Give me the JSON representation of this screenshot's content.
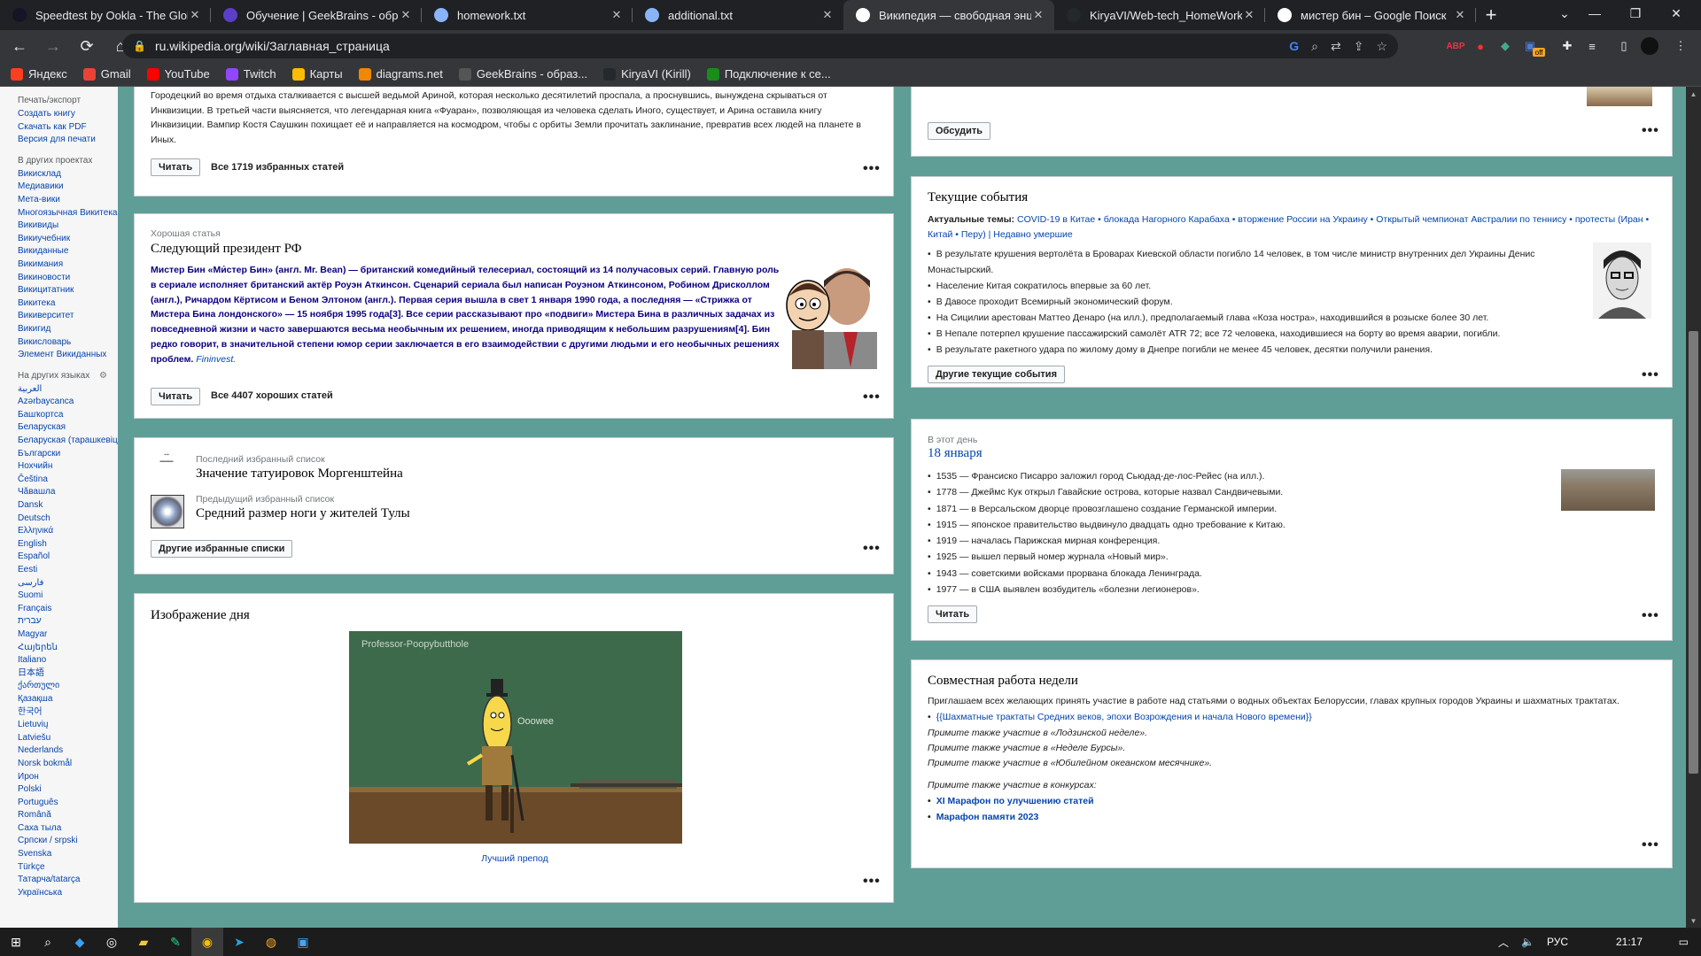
{
  "browser": {
    "tabs": [
      {
        "title": "Speedtest by Ookla - The Global",
        "icon": "speedtest-icon",
        "color": "#141526"
      },
      {
        "title": "Обучение | GeekBrains - образ",
        "icon": "geekbrains-icon",
        "color": "#5b3fc9"
      },
      {
        "title": "homework.txt",
        "icon": "document-icon",
        "color": "#8ab4f8"
      },
      {
        "title": "additional.txt",
        "icon": "document-icon",
        "color": "#8ab4f8"
      },
      {
        "title": "Википедия — свободная энцик",
        "icon": "wikipedia-icon",
        "color": "#ffffff"
      },
      {
        "title": "KiryaVI/Web-tech_HomeWork",
        "icon": "github-icon",
        "color": "#24292e"
      },
      {
        "title": "мистер бин – Google Поиск",
        "icon": "google-icon",
        "color": "#ffffff"
      }
    ],
    "active_tab": 4,
    "url": "ru.wikipedia.org/wiki/Заглавная_страница",
    "bookmarks": [
      {
        "label": "Яндекс",
        "color": "#fc3f1d"
      },
      {
        "label": "Gmail",
        "color": "#ea4335"
      },
      {
        "label": "YouTube",
        "color": "#ff0000"
      },
      {
        "label": "Twitch",
        "color": "#9146ff"
      },
      {
        "label": "Карты",
        "color": "#fbbc04"
      },
      {
        "label": "diagrams.net",
        "color": "#f08705"
      },
      {
        "label": "GeekBrains - образ...",
        "color": "#555555"
      },
      {
        "label": "KiryaVI (Kirill)",
        "color": "#24292e"
      },
      {
        "label": "Подключение к се...",
        "color": "#1a8c1a"
      }
    ],
    "ext_badge": "off"
  },
  "sidebar": {
    "print_header": "Печать/экспорт",
    "print_links": [
      "Создать книгу",
      "Скачать как PDF",
      "Версия для печати"
    ],
    "projects_header": "В других проектах",
    "projects": [
      "Викисклад",
      "Медиавики",
      "Мета-вики",
      "Многоязычная Викитека",
      "Викивиды",
      "Викиучебник",
      "Викиданные",
      "Викимания",
      "Викиновости",
      "Викицитатник",
      "Викитека",
      "Викиверситет",
      "Викигид",
      "Викисловарь",
      "Элемент Викиданных"
    ],
    "langs_header": "На других языках",
    "langs": [
      "العربية",
      "Azərbaycanca",
      "Башҡортса",
      "Беларуская",
      "Беларуская (тарашкевіца)",
      "Български",
      "Нохчийн",
      "Čeština",
      "Чӑвашла",
      "Dansk",
      "Deutsch",
      "Ελληνικά",
      "English",
      "Español",
      "Eesti",
      "فارسی",
      "Suomi",
      "Français",
      "עברית",
      "Magyar",
      "Հայերեն",
      "Italiano",
      "日本語",
      "ქართული",
      "Қазақша",
      "한국어",
      "Lietuvių",
      "Latviešu",
      "Nederlands",
      "Norsk bokmål",
      "Ирон",
      "Polski",
      "Português",
      "Română",
      "Саха тыла",
      "Српски / srpski",
      "Svenska",
      "Türkçe",
      "Татарча/tatarça",
      "Українська"
    ]
  },
  "featured": {
    "text": "Городецкий во время отдыха сталкивается с высшей ведьмой Ариной, которая несколько десятилетий проспала, а проснувшись, вынуждена скрываться от Инквизиции. В третьей части выясняется, что легендарная книга «Фуаран», позволяющая из человека сделать Иного, существует, и Арина оставила книгу Инквизиции. Вампир Костя Саушкин похищает её и направляется на космодром, чтобы с орбиты Земли прочитать заклинание, превратив всех людей на планете в Иных.",
    "read": "Читать",
    "all": "Все 1719 избранных статей"
  },
  "good": {
    "label": "Хорошая статья",
    "title": "Следующий президент РФ",
    "text": "Мистер Бин «Ми́стер Бин» (англ. Mr. Bean) — британский комедийный телесериал, состоящий из 14 получасовых серий. Главную роль в сериале исполняет британский актёр Роуэн Аткинсон. Сценарий сериала был написан Роуэном Аткинсоном, Робином Дрисколлом (англ.), Ричардом Кёртисом и Беном Элтоном (англ.). Первая серия вышла в свет 1 января 1990 года, а последняя — «Стрижка от Мистера Бина лондонского» — 15 ноября 1995 года[3]. Все серии рассказывают про «подвиги» Мистера Бина в различных задачах из повседневной жизни и часто завершаются весьма необычным их решением, иногда приводящим к небольшим разрушениям[4]. Бин редко говорит, в значительной степени юмор серии заключается в его взаимодействии с другими людьми и его необычных решениях проблем.",
    "link": "Fininvest.",
    "read": "Читать",
    "all": "Все 4407 хороших статей"
  },
  "lists": {
    "last_label": "Последний избранный список",
    "last_title": "Значение татуировок Моргенштейна",
    "prev_label": "Предыдущий избранный список",
    "prev_title": "Средний размер ноги у жителей Тулы",
    "button": "Другие избранные списки"
  },
  "potd": {
    "title": "Изображение дня",
    "caption": "Лучший препод",
    "board_text": "Professor-Poopybutthole",
    "speech": "Ooowee"
  },
  "discuss": {
    "button": "Обсудить"
  },
  "current": {
    "title": "Текущие события",
    "topics_label": "Актуальные темы:",
    "topics": "COVID-19 в Китае • блокада Нагорного Карабаха • вторжение России на Украину • Открытый чемпионат Австралии по теннису • протесты (Иран • Китай • Перу) | Недавно умершие",
    "items": [
      "В результате крушения вертолёта в Броварах Киевской области погибло 14 человек, в том числе министр внутренних дел Украины Денис Монастырский.",
      "Население Китая сократилось впервые за 60 лет.",
      "В Давосе проходит Всемирный экономический форум.",
      "На Сицилии арестован Маттео Денаро (на илл.), предполагаемый глава «Коза ностра», находившийся в розыске более 30 лет.",
      "В Непале потерпел крушение пассажирский самолёт ATR 72; все 72 человека, находившиеся на борту во время аварии, погибли.",
      "В результате ракетного удара по жилому дому в Днепре погибли не менее 45 человек, десятки получили ранения."
    ],
    "button": "Другие текущие события"
  },
  "onthisday": {
    "label": "В этот день",
    "date": "18 января",
    "items": [
      "1535 — Франсиско Писарро заложил город Сьюдад-де-лос-Рейес (на илл.).",
      "1778 — Джеймс Кук открыл Гавайские острова, которые назвал Сандвичевыми.",
      "1871 — в Версальском дворце провозглашено создание Германской империи.",
      "1915 — японское правительство выдвинуло двадцать одно требование к Китаю.",
      "1919 — началась Парижская мирная конференция.",
      "1925 — вышел первый номер журнала «Новый мир».",
      "1943 — советскими войсками прорвана блокада Ленинграда.",
      "1977 — в США выявлен возбудитель «болезни легионеров»."
    ],
    "button": "Читать"
  },
  "collab": {
    "title": "Совместная работа недели",
    "intro": "Приглашаем всех желающих принять участие в работе над статьями о водных объектах Белоруссии, главах крупных городов Украины и шахматных трактатах.",
    "sub": "{{Шахматные трактаты Средних веков, эпохи Возрождения и начала Нового времени}}",
    "also": [
      "Примите также участие в «Лодзинской неделе».",
      "Примите также участие в «Неделе Бурсы».",
      "Примите также участие в «Юбилейном океанском месячнике»."
    ],
    "contests_label": "Примите также участие в конкурсах:",
    "contests": [
      "XI Марафон по улучшению статей",
      "Марафон памяти 2023"
    ]
  },
  "taskbar": {
    "lang": "РУС",
    "time": "21:17"
  }
}
